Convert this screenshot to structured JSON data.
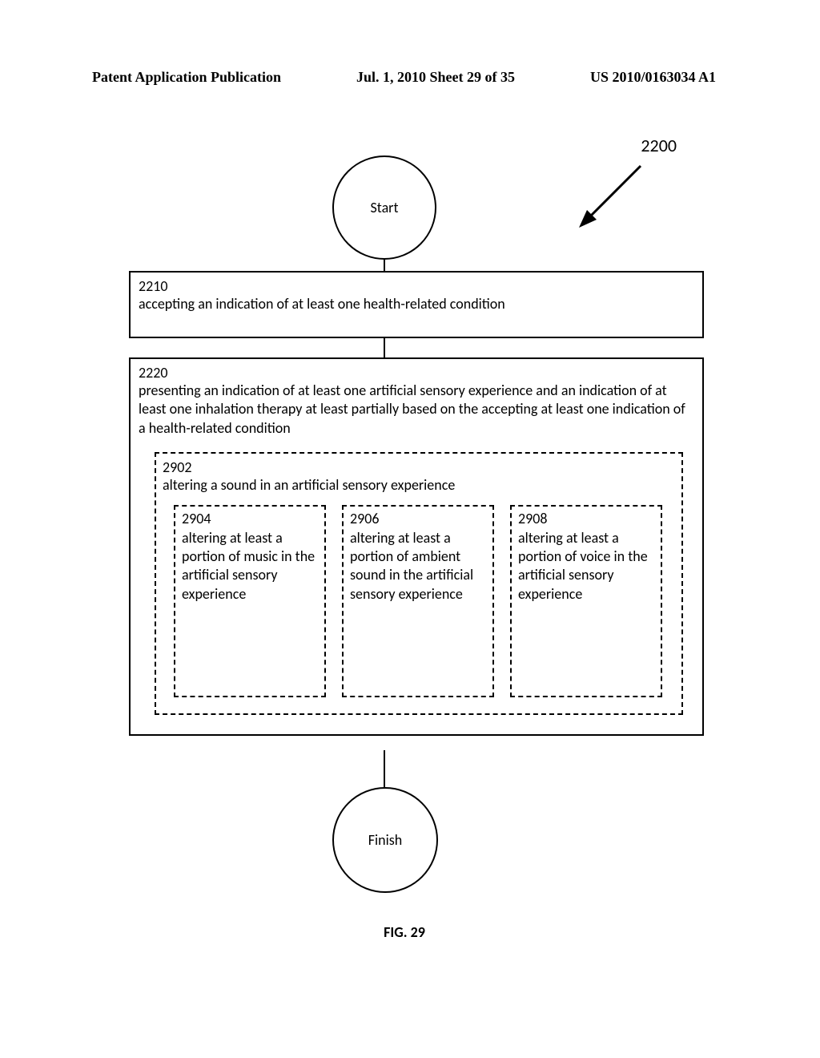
{
  "header": {
    "left": "Patent Application Publication",
    "center": "Jul. 1, 2010  Sheet 29 of 35",
    "right": "US 2010/0163034 A1"
  },
  "callout": "2200",
  "start": {
    "label": "Start"
  },
  "finish": {
    "label": "Finish"
  },
  "box2210": {
    "num": "2210",
    "text": "accepting an indication of at least one health-related condition"
  },
  "box2220": {
    "num": "2220",
    "text": "presenting an indication of at least one artificial sensory experience and an indication of at least one inhalation therapy at least partially based on the accepting at least one indication of a health-related condition"
  },
  "box2902": {
    "num": "2902",
    "text": "altering a sound in an artificial sensory experience"
  },
  "box2904": {
    "num": "2904",
    "text": "altering at least a portion of music in the artificial sensory experience"
  },
  "box2906": {
    "num": "2906",
    "text": "altering at least a portion of ambient sound in the artificial sensory experience"
  },
  "box2908": {
    "num": "2908",
    "text": "altering at least a portion of voice in the artificial sensory experience"
  },
  "figure_label": "FIG. 29"
}
